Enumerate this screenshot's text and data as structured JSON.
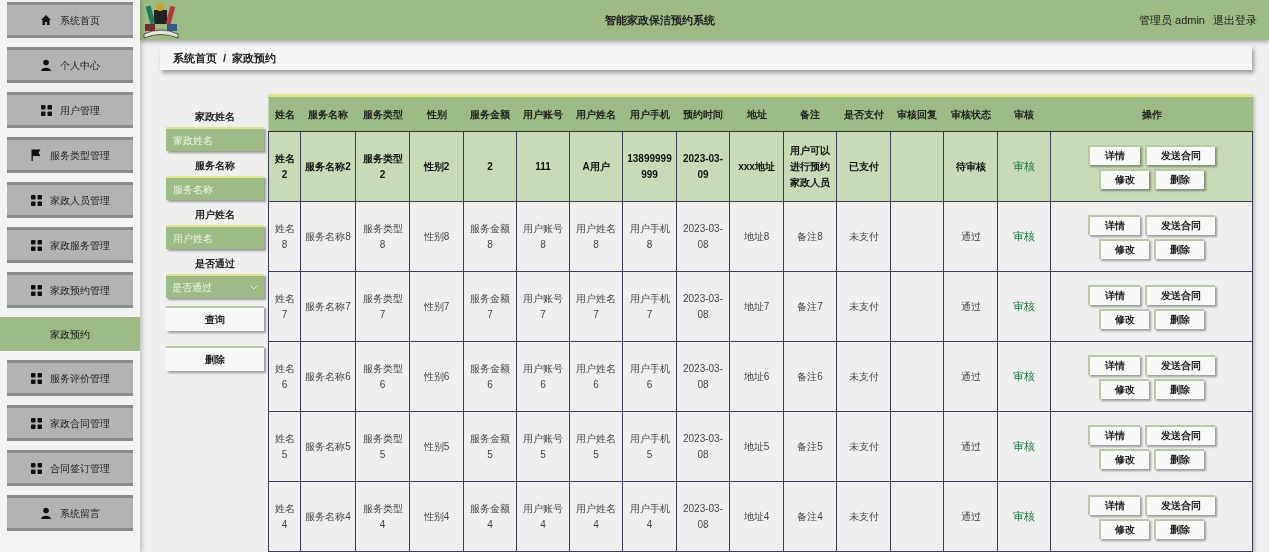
{
  "header": {
    "title": "智能家政保洁预约系统",
    "user": "管理员 admin",
    "logout": "退出登录"
  },
  "sidebar": {
    "items": [
      {
        "label": "系统首页",
        "kind": "main",
        "selected": false
      },
      {
        "label": "个人中心",
        "kind": "main",
        "selected": false
      },
      {
        "label": "用户管理",
        "kind": "main",
        "selected": false
      },
      {
        "label": "服务类型管理",
        "kind": "main",
        "selected": false
      },
      {
        "label": "家政人员管理",
        "kind": "main",
        "selected": false
      },
      {
        "label": "家政服务管理",
        "kind": "main",
        "selected": false
      },
      {
        "label": "家政预约管理",
        "kind": "main",
        "selected": false
      },
      {
        "label": "家政预约",
        "kind": "sub",
        "selected": true
      },
      {
        "label": "服务评价管理",
        "kind": "main",
        "selected": false
      },
      {
        "label": "家政合同管理",
        "kind": "main",
        "selected": false
      },
      {
        "label": "合同签订管理",
        "kind": "main",
        "selected": false
      },
      {
        "label": "系统留言",
        "kind": "main",
        "selected": false
      }
    ]
  },
  "breadcrumb": {
    "items": [
      "系统首页",
      "家政预约"
    ],
    "separator": "/"
  },
  "search": {
    "fields": [
      {
        "label": "家政姓名",
        "placeholder": "家政姓名",
        "kind": "input"
      },
      {
        "label": "服务名称",
        "placeholder": "服务名称",
        "kind": "input"
      },
      {
        "label": "用户姓名",
        "placeholder": "用户姓名",
        "kind": "input"
      },
      {
        "label": "是否通过",
        "placeholder": "是否通过",
        "kind": "select"
      }
    ],
    "buttons": [
      "查询",
      "删除"
    ]
  },
  "table": {
    "columns": [
      "姓名",
      "服务名称",
      "服务类型",
      "性别",
      "服务金额",
      "用户账号",
      "用户姓名",
      "用户手机",
      "预约时间",
      "地址",
      "备注",
      "是否支付",
      "审核回复",
      "审核状态",
      "审核",
      "操作"
    ],
    "rows": [
      {
        "selected": true,
        "cells": [
          "姓名2",
          "服务名称2",
          "服务类型2",
          "性别2",
          "2",
          "111",
          "A用户",
          "13899999999",
          "2023-03-09",
          "xxx地址",
          "用户可以进行预约家政人员",
          "已支付",
          null,
          "待审核"
        ],
        "link": "审核",
        "buttons": [
          "详情",
          "发送合同",
          "修改",
          "删除"
        ]
      },
      {
        "selected": false,
        "cells": [
          "姓名8",
          "服务名称8",
          "服务类型8",
          "性别8",
          "服务金额8",
          "用户账号8",
          "用户姓名8",
          "用户手机8",
          "2023-03-08",
          "地址8",
          "备注8",
          "未支付",
          null,
          "通过"
        ],
        "link": "审核",
        "buttons": [
          "详情",
          "发送合同",
          "修改",
          "删除"
        ]
      },
      {
        "selected": false,
        "cells": [
          "姓名7",
          "服务名称7",
          "服务类型7",
          "性别7",
          "服务金额7",
          "用户账号7",
          "用户姓名7",
          "用户手机7",
          "2023-03-08",
          "地址7",
          "备注7",
          "未支付",
          null,
          "通过"
        ],
        "link": "审核",
        "buttons": [
          "详情",
          "发送合同",
          "修改",
          "删除"
        ]
      },
      {
        "selected": false,
        "cells": [
          "姓名6",
          "服务名称6",
          "服务类型6",
          "性别6",
          "服务金额6",
          "用户账号6",
          "用户姓名6",
          "用户手机6",
          "2023-03-08",
          "地址6",
          "备注6",
          "未支付",
          null,
          "通过"
        ],
        "link": "审核",
        "buttons": [
          "详情",
          "发送合同",
          "修改",
          "删除"
        ]
      },
      {
        "selected": false,
        "cells": [
          "姓名5",
          "服务名称5",
          "服务类型5",
          "性别5",
          "服务金额5",
          "用户账号5",
          "用户姓名5",
          "用户手机5",
          "2023-03-08",
          "地址5",
          "备注5",
          "未支付",
          null,
          "通过"
        ],
        "link": "审核",
        "buttons": [
          "详情",
          "发送合同",
          "修改",
          "删除"
        ]
      },
      {
        "selected": false,
        "cells": [
          "姓名4",
          "服务名称4",
          "服务类型4",
          "性别4",
          "服务金额4",
          "用户账号4",
          "用户姓名4",
          "用户手机4",
          "2023-03-08",
          "地址4",
          "备注4",
          "未支付",
          null,
          "通过"
        ],
        "link": "审核",
        "buttons": [
          "详情",
          "发送合同",
          "修改",
          "删除"
        ]
      }
    ]
  }
}
